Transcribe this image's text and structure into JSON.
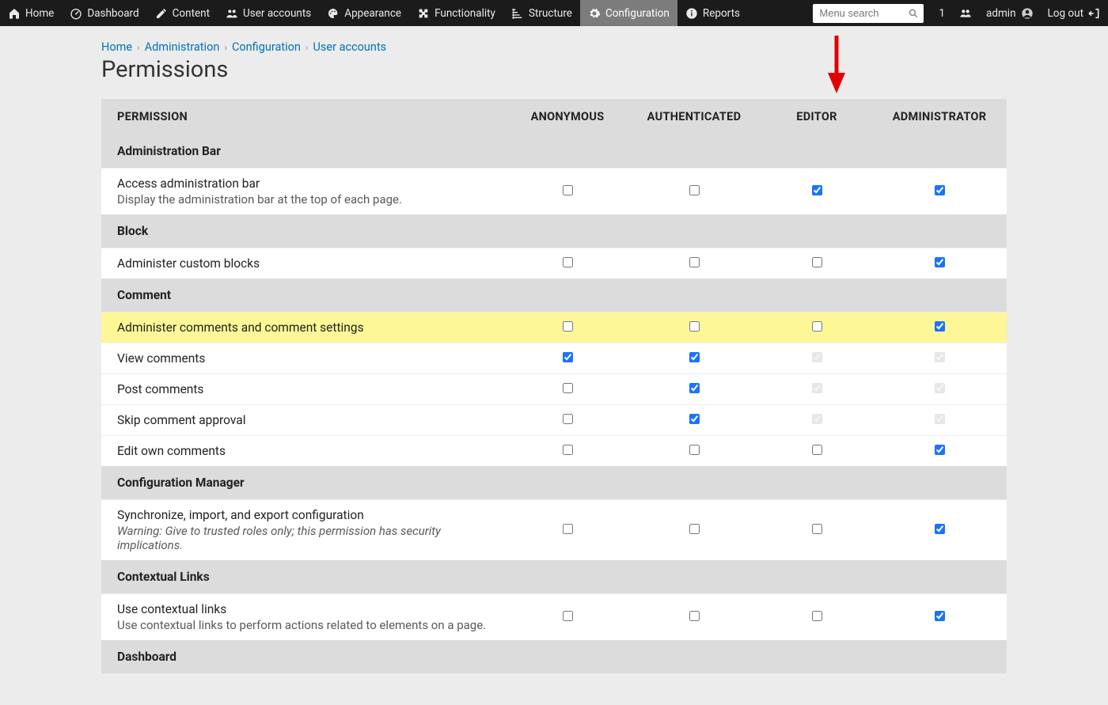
{
  "adminbar": {
    "menu": [
      {
        "icon": "home",
        "label": "Home"
      },
      {
        "icon": "gauge",
        "label": "Dashboard"
      },
      {
        "icon": "pencil",
        "label": "Content"
      },
      {
        "icon": "users",
        "label": "User accounts"
      },
      {
        "icon": "palette",
        "label": "Appearance"
      },
      {
        "icon": "puzzle",
        "label": "Functionality"
      },
      {
        "icon": "structure",
        "label": "Structure"
      },
      {
        "icon": "gear",
        "label": "Configuration",
        "active": true
      },
      {
        "icon": "info",
        "label": "Reports"
      }
    ],
    "search_placeholder": "Menu search",
    "count": "1",
    "user": "admin",
    "logout": "Log out"
  },
  "breadcrumb": [
    "Home",
    "Administration",
    "Configuration",
    "User accounts"
  ],
  "page_title": "Permissions",
  "roles": [
    "PERMISSION",
    "ANONYMOUS",
    "AUTHENTICATED",
    "EDITOR",
    "ADMINISTRATOR"
  ],
  "groups": [
    {
      "name": "Administration Bar",
      "rows": [
        {
          "label": "Access administration bar",
          "desc": "Display the administration bar at the top of each page.",
          "cells": [
            {
              "checked": false
            },
            {
              "checked": false
            },
            {
              "checked": true
            },
            {
              "checked": true
            }
          ]
        }
      ]
    },
    {
      "name": "Block",
      "rows": [
        {
          "label": "Administer custom blocks",
          "cells": [
            {
              "checked": false
            },
            {
              "checked": false
            },
            {
              "checked": false
            },
            {
              "checked": true
            }
          ]
        }
      ]
    },
    {
      "name": "Comment",
      "rows": [
        {
          "label": "Administer comments and comment settings",
          "hl": true,
          "cells": [
            {
              "checked": false
            },
            {
              "checked": false
            },
            {
              "checked": false
            },
            {
              "checked": true
            }
          ]
        },
        {
          "label": "View comments",
          "cells": [
            {
              "checked": true
            },
            {
              "checked": true
            },
            {
              "checked": true,
              "disabled": true
            },
            {
              "checked": true,
              "disabled": true
            }
          ]
        },
        {
          "label": "Post comments",
          "cells": [
            {
              "checked": false
            },
            {
              "checked": true
            },
            {
              "checked": true,
              "disabled": true
            },
            {
              "checked": true,
              "disabled": true
            }
          ]
        },
        {
          "label": "Skip comment approval",
          "cells": [
            {
              "checked": false
            },
            {
              "checked": true
            },
            {
              "checked": true,
              "disabled": true
            },
            {
              "checked": true,
              "disabled": true
            }
          ]
        },
        {
          "label": "Edit own comments",
          "cells": [
            {
              "checked": false
            },
            {
              "checked": false
            },
            {
              "checked": false
            },
            {
              "checked": true
            }
          ]
        }
      ]
    },
    {
      "name": "Configuration Manager",
      "rows": [
        {
          "label": "Synchronize, import, and export configuration",
          "desc": "Warning: Give to trusted roles only; this permission has security implications.",
          "descItalic": true,
          "cells": [
            {
              "checked": false
            },
            {
              "checked": false
            },
            {
              "checked": false
            },
            {
              "checked": true
            }
          ]
        }
      ]
    },
    {
      "name": "Contextual Links",
      "rows": [
        {
          "label": "Use contextual links",
          "desc": "Use contextual links to perform actions related to elements on a page.",
          "cells": [
            {
              "checked": false
            },
            {
              "checked": false
            },
            {
              "checked": false
            },
            {
              "checked": true
            }
          ]
        }
      ]
    },
    {
      "name": "Dashboard",
      "rows": []
    }
  ]
}
